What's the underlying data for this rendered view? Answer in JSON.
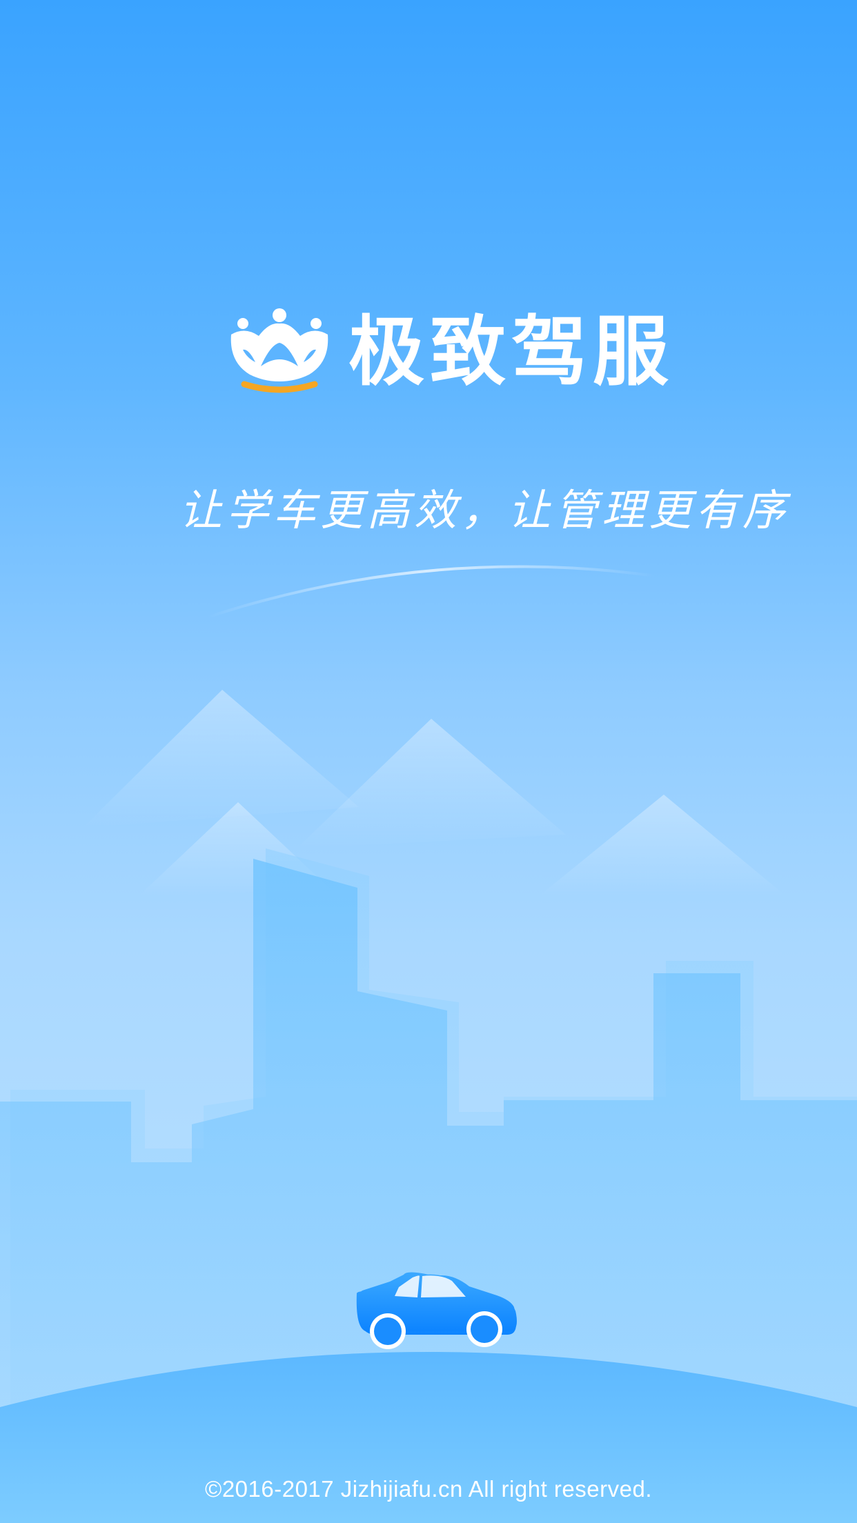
{
  "app": {
    "name": "极致驾服",
    "slogan": "让学车更高效，让管理更有序",
    "copyright": "©2016-2017 Jizhijiafu.cn All right reserved."
  },
  "icons": {
    "logo": "crown-steering-wheel-logo",
    "car": "car-icon"
  },
  "colors": {
    "primary": "#3aa3ff",
    "sky_light": "#bfe3ff",
    "car_blue": "#1a8dff",
    "accent_orange": "#f5a623",
    "text": "#ffffff"
  }
}
